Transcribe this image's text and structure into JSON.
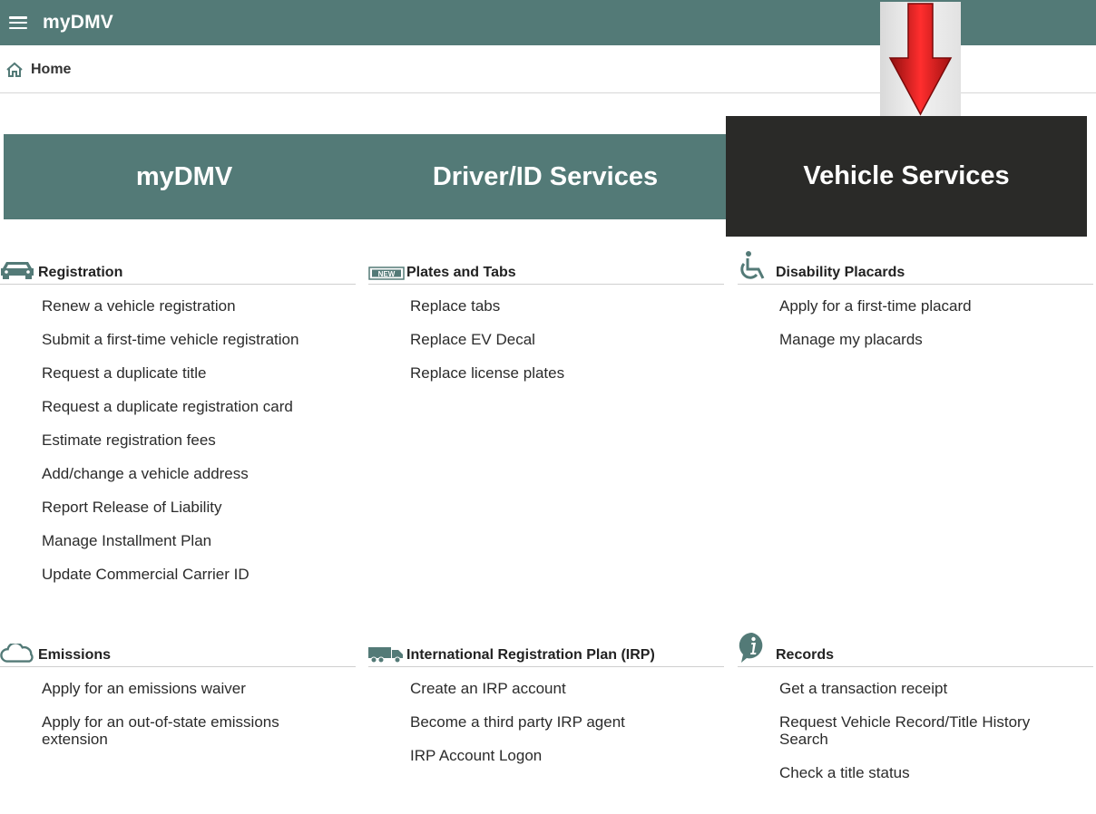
{
  "app": {
    "title": "myDMV"
  },
  "breadcrumb": {
    "home": "Home"
  },
  "tabs": [
    {
      "label": "myDMV"
    },
    {
      "label": "Driver/ID Services"
    },
    {
      "label": "Vehicle Services",
      "active": true
    }
  ],
  "colors": {
    "header": "#537a77",
    "active_tab": "#2a2a28",
    "arrow": "#d71a1a"
  },
  "sections": {
    "registration": {
      "title": "Registration",
      "icon": "car-icon",
      "links": [
        "Renew a vehicle registration",
        "Submit a first-time vehicle registration",
        "Request a duplicate title",
        "Request a duplicate registration card",
        "Estimate registration fees",
        "Add/change a vehicle address",
        "Report Release of Liability",
        "Manage Installment Plan",
        "Update Commercial Carrier ID"
      ]
    },
    "plates": {
      "title": "Plates and Tabs",
      "icon": "new-badge-icon",
      "badge": "NEW",
      "links": [
        "Replace tabs",
        "Replace EV Decal",
        "Replace license plates"
      ]
    },
    "placards": {
      "title": "Disability Placards",
      "icon": "wheelchair-icon",
      "links": [
        "Apply for a first-time placard",
        "Manage my placards"
      ]
    },
    "emissions": {
      "title": "Emissions",
      "icon": "cloud-icon",
      "links": [
        "Apply for an emissions waiver",
        "Apply for an out-of-state emissions extension"
      ]
    },
    "irp": {
      "title": "International Registration Plan (IRP)",
      "icon": "truck-icon",
      "links": [
        "Create an IRP account",
        "Become a third party IRP agent",
        "IRP Account Logon"
      ]
    },
    "records": {
      "title": "Records",
      "icon": "info-icon",
      "links": [
        "Get a transaction receipt",
        "Request Vehicle Record/Title History Search",
        "Check a title status"
      ]
    }
  }
}
